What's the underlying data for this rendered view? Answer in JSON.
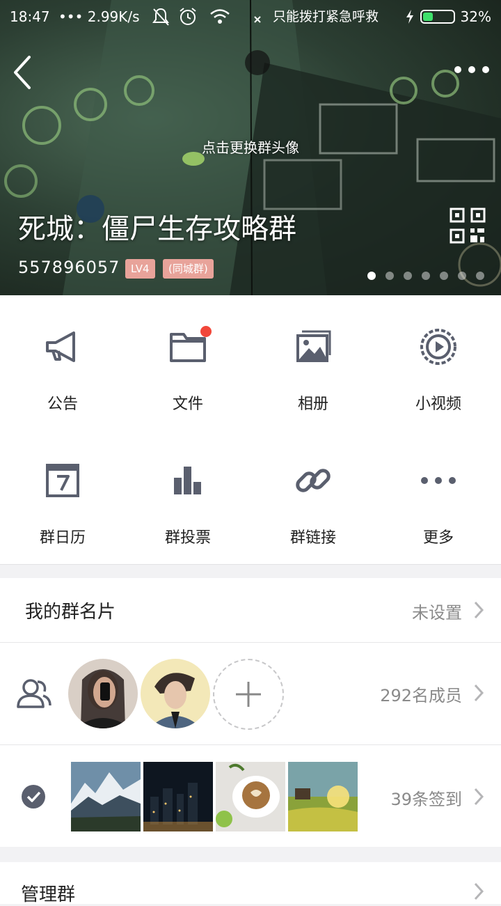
{
  "status_bar": {
    "time": "18:47",
    "net_speed": "2.99K/s",
    "carrier_text": "只能拨打紧急呼救",
    "battery": "32%",
    "battery_level": 0.32
  },
  "header": {
    "change_avatar_hint": "点击更换群头像",
    "group_name": "死城：僵尸生存攻略群",
    "group_id": "557896057",
    "level_tag": "LV4",
    "type_tag": "(同城群)",
    "page_dots": 7,
    "active_dot": 0
  },
  "features": [
    {
      "label": "公告",
      "icon": "megaphone-icon"
    },
    {
      "label": "文件",
      "icon": "folder-icon"
    },
    {
      "label": "相册",
      "icon": "photo-album-icon"
    },
    {
      "label": "小视频",
      "icon": "video-icon"
    },
    {
      "label": "群日历",
      "icon": "calendar-icon"
    },
    {
      "label": "群投票",
      "icon": "bar-chart-icon"
    },
    {
      "label": "群链接",
      "icon": "link-icon"
    },
    {
      "label": "更多",
      "icon": "more-dots-icon"
    }
  ],
  "card": {
    "label": "我的群名片",
    "value": "未设置"
  },
  "members": {
    "count_text": "292名成员"
  },
  "checkin": {
    "count_text": "39条签到"
  },
  "admin": {
    "label": "管理群"
  },
  "colors": {
    "icon_gray": "#5a5f6e",
    "tag_pink": "#e8a39a",
    "badge_red": "#f2473a",
    "battery_green": "#3fe06b"
  }
}
